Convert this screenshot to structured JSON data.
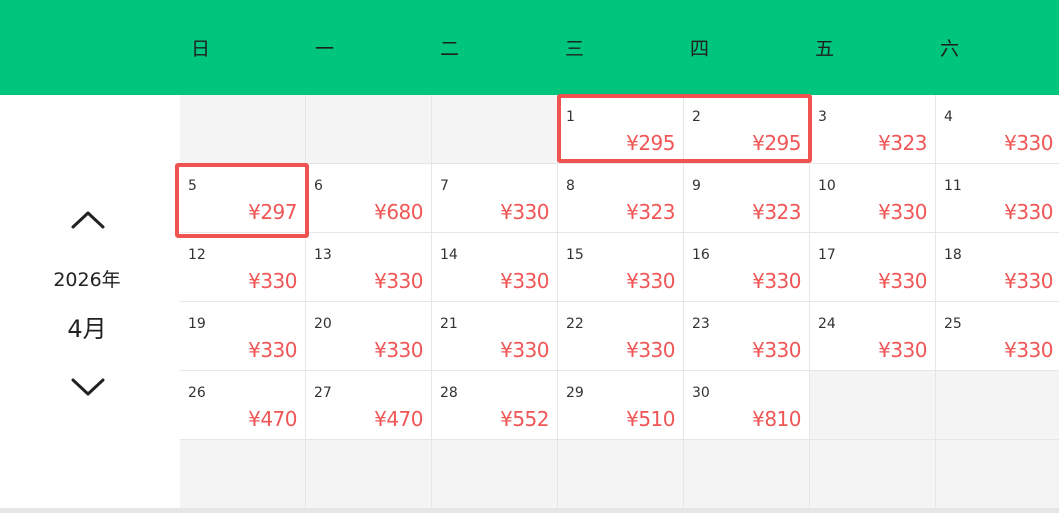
{
  "weekdays": [
    "日",
    "一",
    "二",
    "三",
    "四",
    "五",
    "六"
  ],
  "nav": {
    "year": "2026年",
    "month": "4月"
  },
  "calendar": {
    "days": [
      {
        "day": "1",
        "price": "¥295"
      },
      {
        "day": "2",
        "price": "¥295"
      },
      {
        "day": "3",
        "price": "¥323"
      },
      {
        "day": "4",
        "price": "¥330"
      },
      {
        "day": "5",
        "price": "¥297"
      },
      {
        "day": "6",
        "price": "¥680"
      },
      {
        "day": "7",
        "price": "¥330"
      },
      {
        "day": "8",
        "price": "¥323"
      },
      {
        "day": "9",
        "price": "¥323"
      },
      {
        "day": "10",
        "price": "¥330"
      },
      {
        "day": "11",
        "price": "¥330"
      },
      {
        "day": "12",
        "price": "¥330"
      },
      {
        "day": "13",
        "price": "¥330"
      },
      {
        "day": "14",
        "price": "¥330"
      },
      {
        "day": "15",
        "price": "¥330"
      },
      {
        "day": "16",
        "price": "¥330"
      },
      {
        "day": "17",
        "price": "¥330"
      },
      {
        "day": "18",
        "price": "¥330"
      },
      {
        "day": "19",
        "price": "¥330"
      },
      {
        "day": "20",
        "price": "¥330"
      },
      {
        "day": "21",
        "price": "¥330"
      },
      {
        "day": "22",
        "price": "¥330"
      },
      {
        "day": "23",
        "price": "¥330"
      },
      {
        "day": "24",
        "price": "¥330"
      },
      {
        "day": "25",
        "price": "¥330"
      },
      {
        "day": "26",
        "price": "¥470"
      },
      {
        "day": "27",
        "price": "¥470"
      },
      {
        "day": "28",
        "price": "¥552"
      },
      {
        "day": "29",
        "price": "¥510"
      },
      {
        "day": "30",
        "price": "¥810"
      }
    ]
  },
  "colors": {
    "header_bg": "#00c57c",
    "price": "#f05656",
    "highlight_border": "#f05252"
  },
  "icons": {
    "prev_month": "chevron-up-icon",
    "next_month": "chevron-down-icon"
  }
}
